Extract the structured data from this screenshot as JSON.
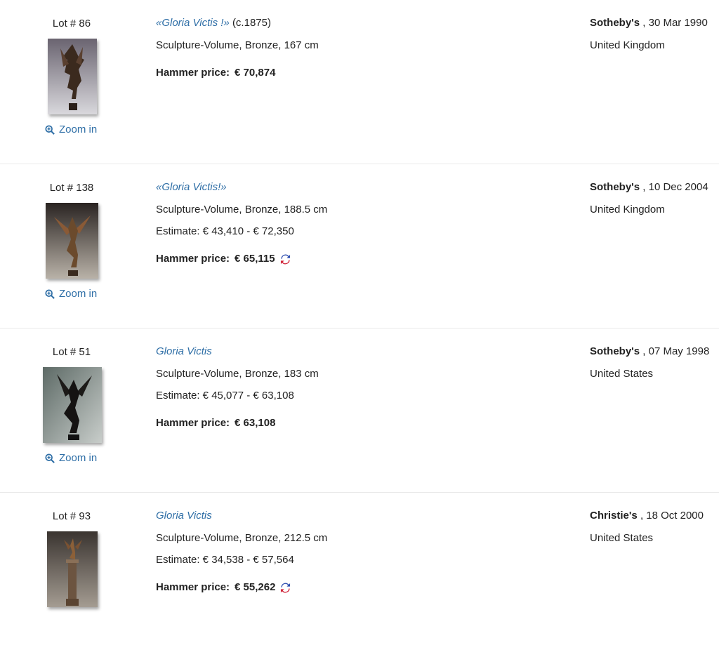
{
  "zoom_label": "Zoom in",
  "hammer_prefix": "Hammer price:",
  "lots": [
    {
      "lot": "Lot # 86",
      "title": "«Gloria Victis !»",
      "title_suffix": "(c.1875)",
      "medium": "Sculpture-Volume, Bronze, 167 cm",
      "estimate": "",
      "hammer": "€ 70,874",
      "house": "Sotheby's",
      "date": ", 30 Mar 1990",
      "country": "United Kingdom"
    },
    {
      "lot": "Lot # 138",
      "title": "«Gloria Victis!»",
      "title_suffix": "",
      "medium": "Sculpture-Volume, Bronze, 188.5 cm",
      "estimate": "Estimate: € 43,410 - € 72,350",
      "hammer": "€ 65,115",
      "house": "Sotheby's",
      "date": ", 10 Dec 2004",
      "country": "United Kingdom"
    },
    {
      "lot": "Lot # 51",
      "title": "Gloria Victis",
      "title_suffix": "",
      "medium": "Sculpture-Volume, Bronze, 183 cm",
      "estimate": "Estimate: € 45,077 - € 63,108",
      "hammer": "€ 63,108",
      "house": "Sotheby's",
      "date": ", 07 May 1998",
      "country": "United States"
    },
    {
      "lot": "Lot # 93",
      "title": "Gloria Victis",
      "title_suffix": "",
      "medium": "Sculpture-Volume, Bronze, 212.5 cm",
      "estimate": "Estimate: € 34,538 - € 57,564",
      "hammer": "€ 55,262",
      "house": "Christie's",
      "date": ", 18 Oct 2000",
      "country": "United States"
    }
  ]
}
